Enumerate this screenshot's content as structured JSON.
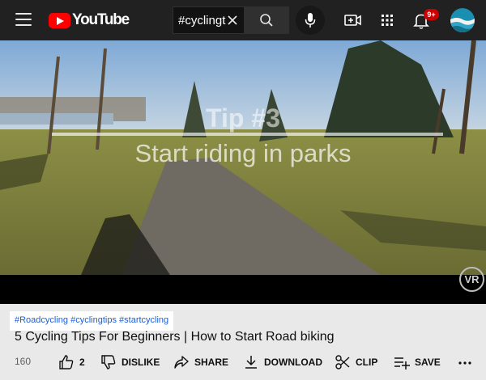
{
  "header": {
    "logo_text": "YouTube",
    "search_value": "#cyclingt",
    "notification_count": "9+"
  },
  "video": {
    "overlay_title": "Tip #3",
    "overlay_subtitle": "Start riding in parks",
    "watermark": "VR"
  },
  "info": {
    "hashtags": [
      "#Roadcycling",
      "#cyclingtips",
      "#startcycling"
    ],
    "title": "5 Cycling Tips For Beginners | How to Start Road biking",
    "views": "160"
  },
  "actions": {
    "like_count": "2",
    "dislike_label": "DISLIKE",
    "share_label": "SHARE",
    "download_label": "DOWNLOAD",
    "clip_label": "CLIP",
    "save_label": "SAVE"
  },
  "colors": {
    "header_bg": "#212121",
    "brand_red": "#ff0000",
    "hashtag_blue": "#1a5fd6",
    "badge_red": "#cc0000"
  }
}
